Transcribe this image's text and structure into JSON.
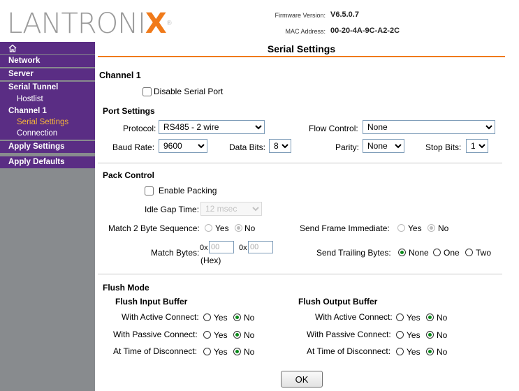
{
  "header": {
    "logo_text": "LANTRONIX",
    "firmware_label": "Firmware Version:",
    "firmware_value": "V6.5.0.7",
    "mac_label": "MAC Address:",
    "mac_value": "00-20-4A-9C-A2-2C"
  },
  "sidebar": {
    "home_icon": "home-icon",
    "items": [
      {
        "label": "Network"
      },
      {
        "label": "Server"
      },
      {
        "label": "Serial Tunnel"
      },
      {
        "label": "Hostlist"
      },
      {
        "label": "Channel 1"
      },
      {
        "label": "Serial Settings"
      },
      {
        "label": "Connection"
      },
      {
        "label": "Apply Settings"
      },
      {
        "label": "Apply Defaults"
      }
    ]
  },
  "page_title": "Serial Settings",
  "channel": {
    "title": "Channel 1",
    "disable_label": "Disable Serial Port"
  },
  "port_settings": {
    "heading": "Port Settings",
    "protocol_label": "Protocol:",
    "protocol_value": "RS485 - 2 wire",
    "flow_label": "Flow Control:",
    "flow_value": "None",
    "baud_label": "Baud Rate:",
    "baud_value": "9600",
    "databits_label": "Data Bits:",
    "databits_value": "8",
    "parity_label": "Parity:",
    "parity_value": "None",
    "stopbits_label": "Stop Bits:",
    "stopbits_value": "1"
  },
  "pack_control": {
    "heading": "Pack Control",
    "enable_label": "Enable Packing",
    "idle_label": "Idle Gap Time:",
    "idle_value": "12 msec",
    "match2_label": "Match 2 Byte Sequence:",
    "yes": "Yes",
    "no": "No",
    "send_frame_label": "Send Frame Immediate:",
    "match_bytes_label": "Match Bytes:",
    "hex_prefix": "0x",
    "hex_value1": "00",
    "hex_value2": "00",
    "hex_note": "(Hex)",
    "trailing_label": "Send Trailing Bytes:",
    "trailing_none": "None",
    "trailing_one": "One",
    "trailing_two": "Two"
  },
  "flush_mode": {
    "heading": "Flush Mode",
    "input_heading": "Flush Input Buffer",
    "output_heading": "Flush Output Buffer",
    "active_label": "With Active Connect:",
    "passive_label": "With Passive Connect:",
    "disconnect_label": "At Time of Disconnect:",
    "yes": "Yes",
    "no": "No"
  },
  "ok_label": "OK"
}
